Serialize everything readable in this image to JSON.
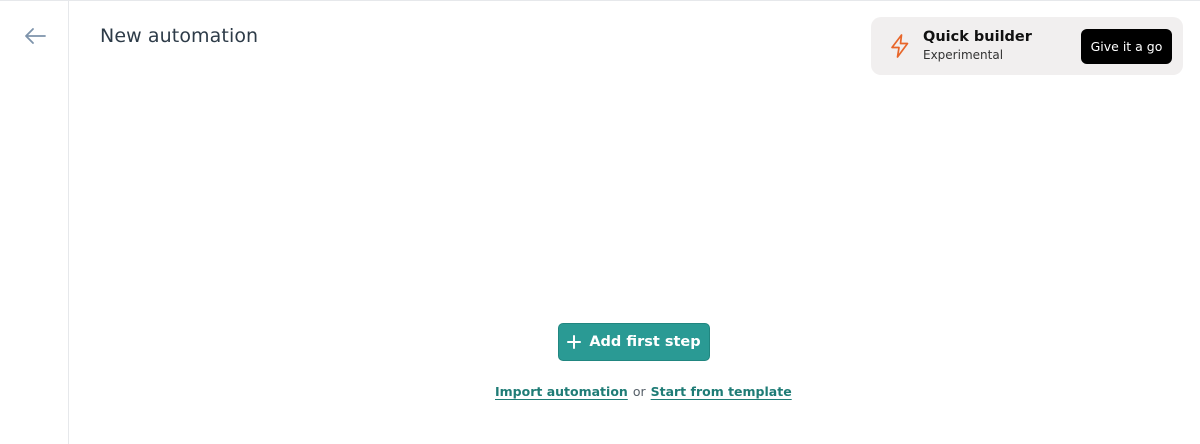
{
  "header": {
    "title": "New automation"
  },
  "quick_builder": {
    "title": "Quick builder",
    "subtitle": "Experimental",
    "button_label": "Give it a go",
    "icon": "lightning-bolt-icon",
    "accent_color": "#e8662a"
  },
  "canvas": {
    "add_step_label": "Add first step",
    "import_link": "Import automation",
    "or_text": "or",
    "template_link": "Start from template"
  },
  "colors": {
    "primary": "#2a9a94",
    "link": "#1f7c76",
    "back_arrow": "#7d93ab"
  },
  "icons": {
    "back": "arrow-left-icon",
    "add": "plus-icon"
  }
}
